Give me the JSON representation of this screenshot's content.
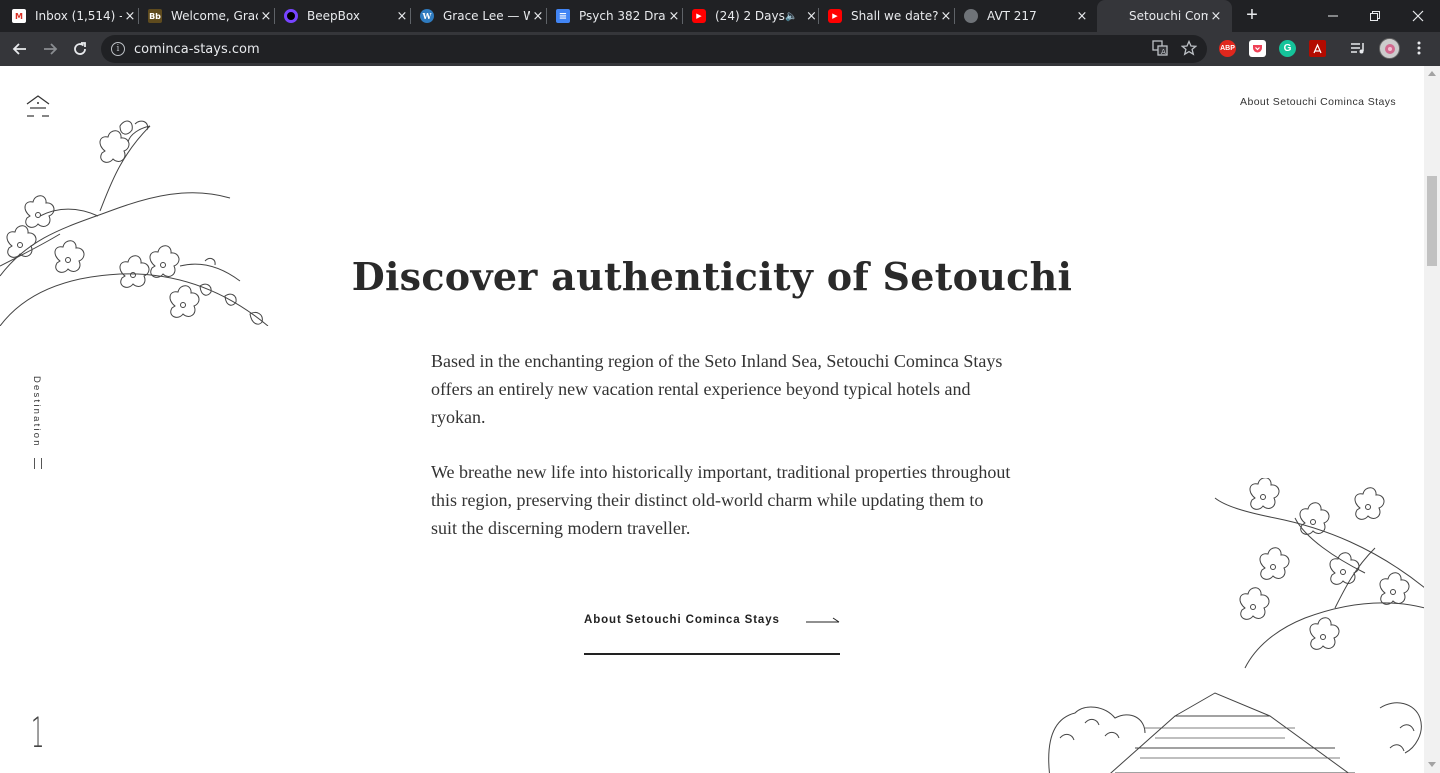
{
  "browser": {
    "tabs": [
      {
        "title": "Inbox (1,514) -",
        "icon": "gmail-icon",
        "color": "#d93025",
        "glyph": "M"
      },
      {
        "title": "Welcome, Grac",
        "icon": "blackboard-icon",
        "color": "#5f4b1e",
        "glyph": "Bb"
      },
      {
        "title": "BeepBox",
        "icon": "beepbox-icon",
        "color": "#7744ff",
        "glyph": ""
      },
      {
        "title": "Grace Lee — W",
        "icon": "wordpress-icon",
        "color": "#2f7bbf",
        "glyph": "W"
      },
      {
        "title": "Psych 382 Draf",
        "icon": "google-docs-icon",
        "color": "#4285f4",
        "glyph": "≡"
      },
      {
        "title": "(24) 2 Days",
        "icon": "youtube-icon",
        "color": "#ff0000",
        "glyph": "▶"
      },
      {
        "title": "Shall we date?",
        "icon": "youtube-icon",
        "color": "#ff0000",
        "glyph": "▶"
      },
      {
        "title": "AVT 217",
        "icon": "globe-icon",
        "color": "#6f7378",
        "glyph": ""
      },
      {
        "title": "Setouchi Comi",
        "icon": "",
        "color": "",
        "glyph": ""
      }
    ],
    "url": "cominca-stays.com",
    "new_tab": "+",
    "close": "×"
  },
  "page": {
    "top_link": "About Setouchi Cominca Stays",
    "side_nav": "Destination",
    "page_number": "1",
    "title": "Discover authenticity of Setouchi",
    "paragraph1": "Based in the enchanting region of the Seto Inland Sea, Setouchi Cominca Stays offers an entirely new vacation rental experience beyond typical hotels and ryokan.",
    "paragraph2": "We breathe new life into historically important, traditional properties throughout this region, preserving their distinct old-world charm while updating them to suit the discerning modern traveller.",
    "cta_label": "About Setouchi Cominca Stays"
  }
}
